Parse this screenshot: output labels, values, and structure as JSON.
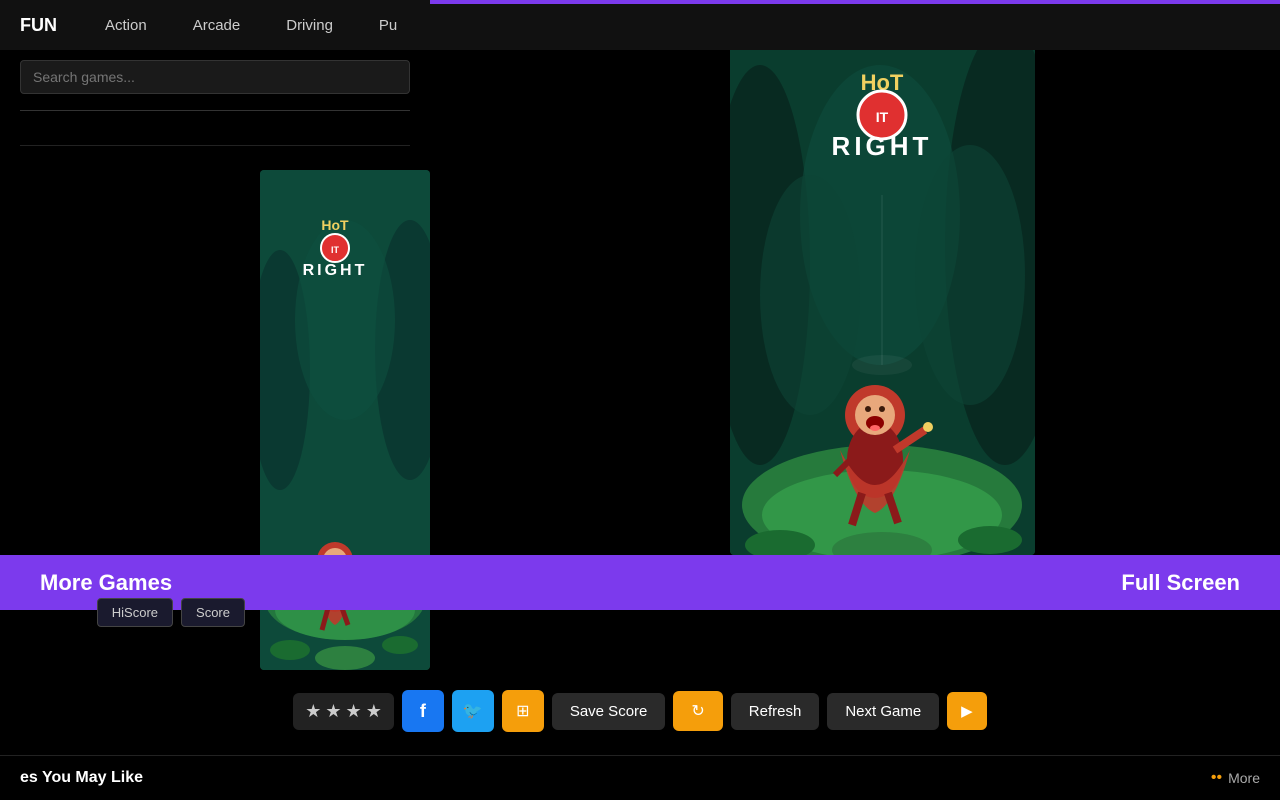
{
  "brand": {
    "logo": "FUN"
  },
  "nav": {
    "items": [
      {
        "id": "action",
        "label": "Action"
      },
      {
        "id": "arcade",
        "label": "Arcade"
      },
      {
        "id": "driving",
        "label": "Driving"
      },
      {
        "id": "puzzle",
        "label": "Pu"
      }
    ]
  },
  "search": {
    "placeholder": "Search games..."
  },
  "game": {
    "title": "Hot It Right",
    "logo_top": "HoT",
    "logo_circle": "IT",
    "logo_bottom": "RIGHT"
  },
  "banners": {
    "more_games": "More Games",
    "full_screen": "Full Screen"
  },
  "actions": {
    "save_score": "Save Score",
    "refresh": "Refresh",
    "next_game": "Next Game"
  },
  "bottom": {
    "may_like": "es You May Like",
    "more": "More"
  },
  "colors": {
    "purple": "#7c3aed",
    "yellow": "#f59e0b",
    "facebook": "#1877f2",
    "twitter": "#1da1f2",
    "dark_bg": "#000000",
    "nav_bg": "#111111"
  }
}
